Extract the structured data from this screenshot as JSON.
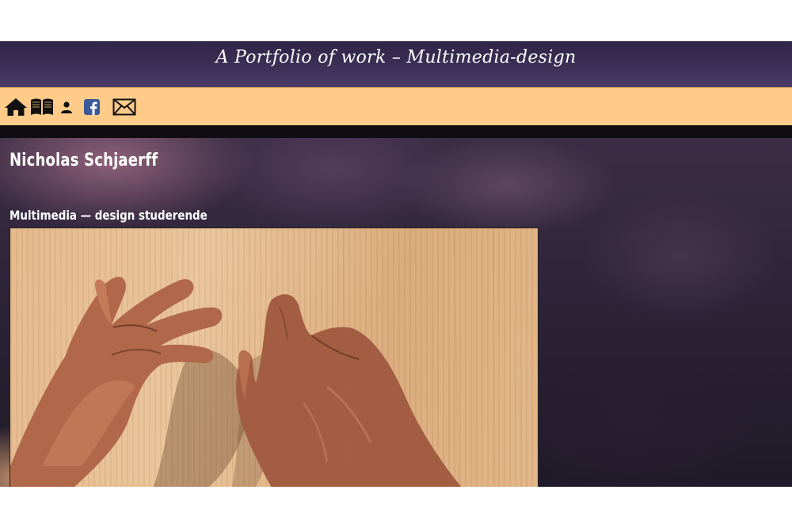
{
  "header": {
    "title": "A Portfolio of work – Multimedia-design"
  },
  "nav": {
    "items": [
      {
        "icon": "home-icon"
      },
      {
        "icon": "book-icon"
      },
      {
        "icon": "user-icon"
      },
      {
        "icon": "facebook-icon"
      },
      {
        "icon": "mail-icon"
      }
    ]
  },
  "main": {
    "name": "Nicholas Schjaerff",
    "subtitle": "Multimedia — design studerende"
  },
  "colors": {
    "header_bg": "#3d3158",
    "nav_bg": "#fecb88",
    "divider": "#0f0d10",
    "facebook_blue": "#3b5998"
  }
}
